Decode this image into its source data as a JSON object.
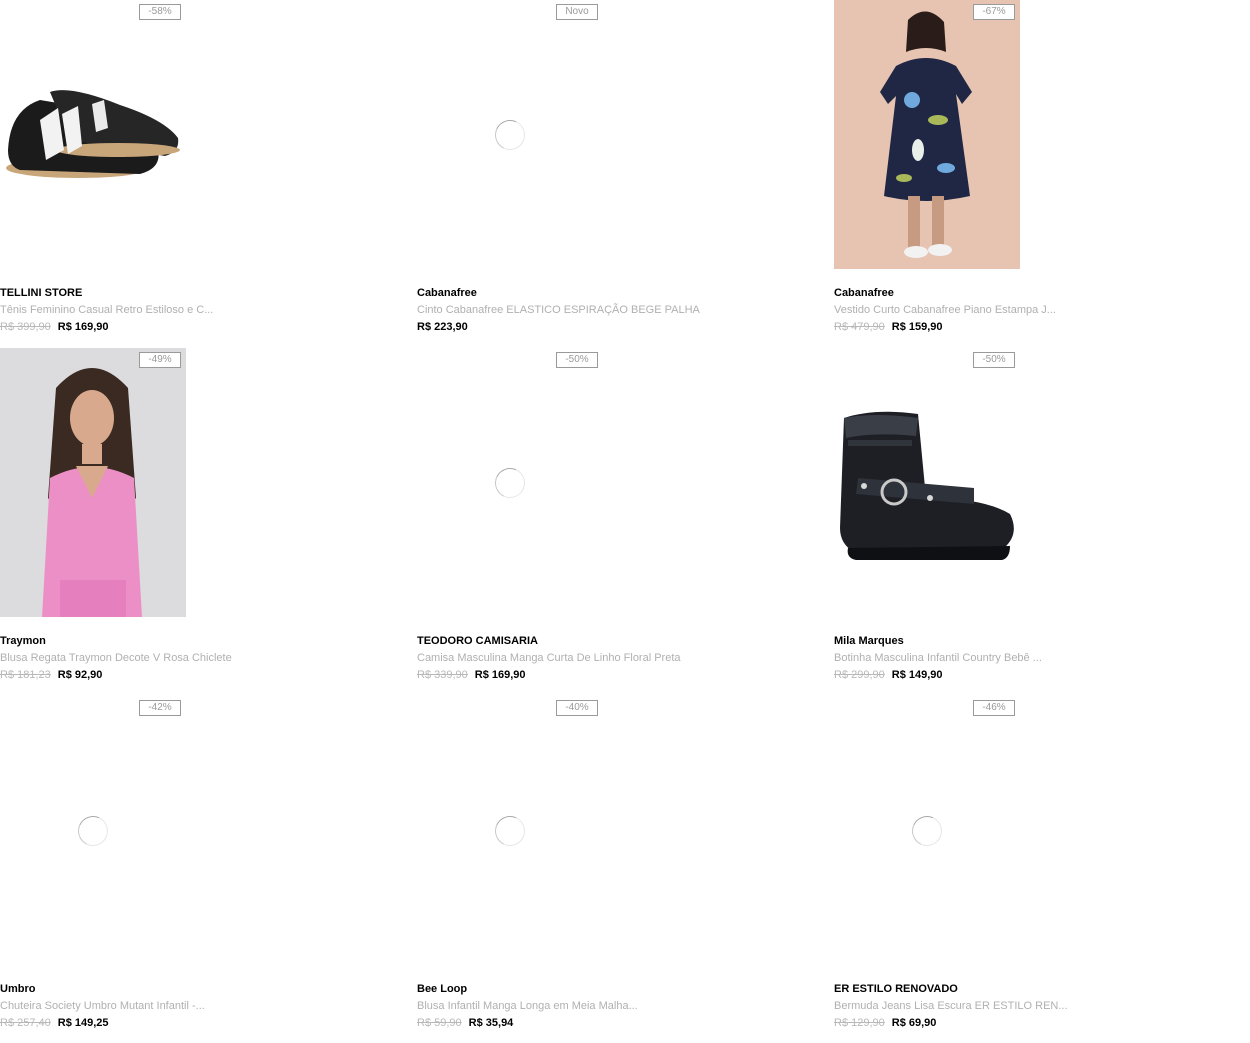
{
  "products": [
    {
      "brand": "TELLINI STORE",
      "name": "Tênis Feminino Casual Retro Estiloso e C...",
      "old_price": "R$ 399,90",
      "price": "R$ 169,90",
      "badge": "-58%",
      "image": "sneaker",
      "image_loading": false
    },
    {
      "brand": "Cabanafree",
      "name": "Cinto Cabanafree ELASTICO ESPIRAÇÃO BEGE PALHA",
      "old_price": "",
      "price": "R$ 223,90",
      "badge": "Novo",
      "image": "loading",
      "image_loading": true
    },
    {
      "brand": "Cabanafree",
      "name": "Vestido Curto Cabanafree Piano Estampa J...",
      "old_price": "R$ 479,90",
      "price": "R$ 159,90",
      "badge": "-67%",
      "image": "dress",
      "image_loading": false
    },
    {
      "brand": "Traymon",
      "name": "Blusa Regata Traymon Decote V Rosa Chiclete",
      "old_price": "R$ 181,23",
      "price": "R$ 92,90",
      "badge": "-49%",
      "image": "pink-top",
      "image_loading": false
    },
    {
      "brand": "TEODORO CAMISARIA",
      "name": "Camisa Masculina Manga Curta De Linho Floral Preta",
      "old_price": "R$ 339,90",
      "price": "R$ 169,90",
      "badge": "-50%",
      "image": "loading",
      "image_loading": true
    },
    {
      "brand": "Mila Marques",
      "name": "Botinha Masculina Infantil Country Bebê ...",
      "old_price": "R$ 299,90",
      "price": "R$ 149,90",
      "badge": "-50%",
      "image": "boot",
      "image_loading": false
    },
    {
      "brand": "Umbro",
      "name": "Chuteira Society Umbro Mutant Infantil -...",
      "old_price": "R$ 257,40",
      "price": "R$ 149,25",
      "badge": "-42%",
      "image": "loading",
      "image_loading": true
    },
    {
      "brand": "Bee Loop",
      "name": "Blusa Infantil Manga Longa em Meia Malha...",
      "old_price": "R$ 59,90",
      "price": "R$ 35,94",
      "badge": "-40%",
      "image": "loading",
      "image_loading": true
    },
    {
      "brand": "ER ESTILO RENOVADO",
      "name": "Bermuda Jeans Lisa Escura ER ESTILO REN...",
      "old_price": "R$ 129,90",
      "price": "R$ 69,90",
      "badge": "-46%",
      "image": "loading",
      "image_loading": true
    }
  ],
  "colors": {
    "badge_border": "#9a9a9a",
    "old_price": "#b8b8b8",
    "name_text": "#b0b0b0",
    "brand_text": "#000000"
  }
}
